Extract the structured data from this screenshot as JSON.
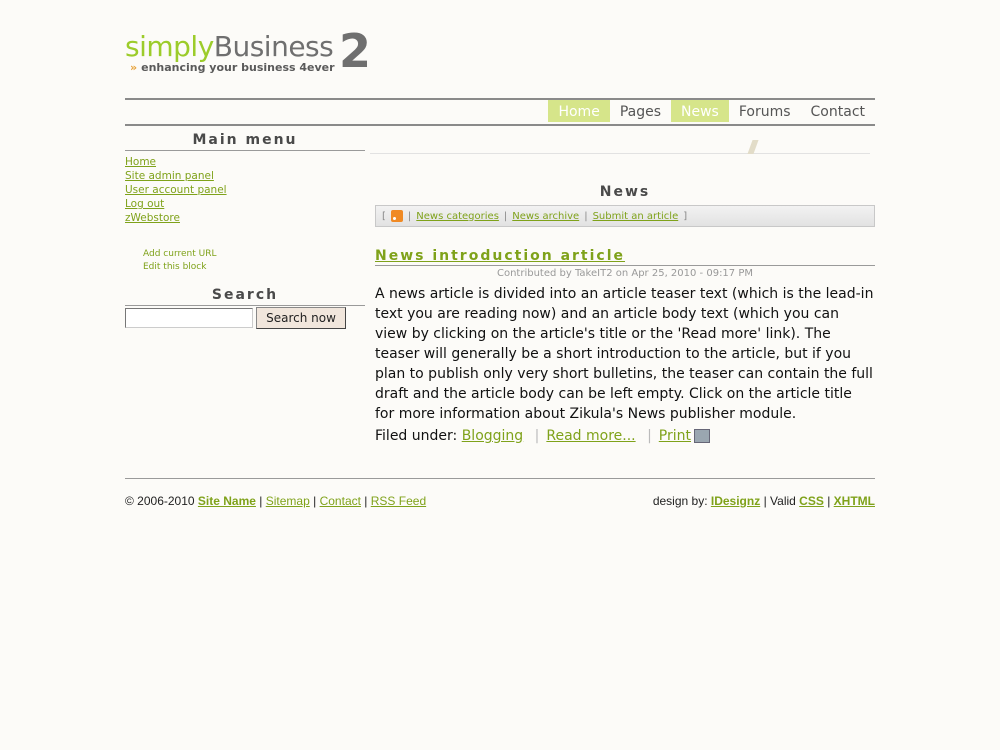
{
  "logo": {
    "simply": "simply",
    "business": "Business",
    "number": "2",
    "tagline": "enhancing your business 4ever",
    "tag_arrow": "»"
  },
  "nav": [
    {
      "label": "Home",
      "active": true
    },
    {
      "label": "Pages",
      "active": false
    },
    {
      "label": "News",
      "active": true
    },
    {
      "label": "Forums",
      "active": false
    },
    {
      "label": "Contact",
      "active": false
    }
  ],
  "sidebar": {
    "main_menu_title": "Main menu",
    "menu": [
      "Home",
      "Site admin panel",
      "User account panel",
      "Log out",
      "zWebstore"
    ],
    "block_admin": [
      "Add current URL",
      "Edit this block"
    ],
    "search_title": "Search",
    "search_button": "Search now",
    "search_value": ""
  },
  "news": {
    "title": "News",
    "bar": {
      "open": "[",
      "close": "]",
      "sep": "|",
      "links": [
        "News categories",
        "News archive",
        "Submit an article"
      ],
      "icon": "rss-icon"
    },
    "article": {
      "title": "News introduction article",
      "meta": "Contributed by TakeIT2 on Apr 25, 2010 - 09:17 PM",
      "body": "A news article is divided into an article teaser text (which is the lead-in text you are reading now) and an article body text (which you can view by clicking on the article's title or the 'Read more' link). The teaser will generally be a short introduction to the article, but if you plan to publish only very short bulletins, the teaser can contain the full draft and the article body can be left empty. Click on the article title for more information about Zikula's News publisher module.",
      "filed_label": "Filed under:",
      "category": "Blogging",
      "read_more": "Read more...",
      "print": "Print",
      "sep": "|"
    }
  },
  "footer": {
    "copyright": "© 2006-2010",
    "site_name": "Site Name",
    "links": [
      "Sitemap",
      "Contact",
      "RSS Feed"
    ],
    "design_by": "design by:",
    "designer": "IDesignz",
    "valid": "Valid",
    "css": "CSS",
    "xhtml": "XHTML",
    "sep": "|"
  },
  "colors": {
    "accent": "#7fa21a",
    "nav_active": "#d6e58a",
    "logo_green": "#9ccc2a"
  }
}
